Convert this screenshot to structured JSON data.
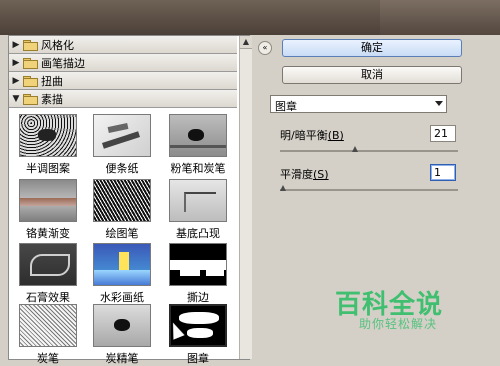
{
  "left_panel": {
    "groups": [
      {
        "label": "风格化"
      },
      {
        "label": "画笔描边"
      },
      {
        "label": "扭曲"
      },
      {
        "label": "素描"
      }
    ],
    "thumbnails": [
      {
        "label": "半调图案"
      },
      {
        "label": "便条纸"
      },
      {
        "label": "粉笔和炭笔"
      },
      {
        "label": "铬黄渐变"
      },
      {
        "label": "绘图笔"
      },
      {
        "label": "基底凸现"
      },
      {
        "label": "石膏效果"
      },
      {
        "label": "水彩画纸"
      },
      {
        "label": "撕边"
      },
      {
        "label": "炭笔"
      },
      {
        "label": "炭精笔"
      },
      {
        "label": "图章"
      }
    ]
  },
  "right_panel": {
    "ok_label": "确定",
    "cancel_label": "取消",
    "filter_select": "图章",
    "params": [
      {
        "label": "明/暗平衡",
        "key": "(B)",
        "value": "21",
        "level": 0.42
      },
      {
        "label": "平滑度",
        "key": "(S)",
        "value": "1",
        "level": 0.0
      }
    ]
  },
  "watermark": {
    "title": "百科全说",
    "subtitle": "助你轻松解决"
  }
}
